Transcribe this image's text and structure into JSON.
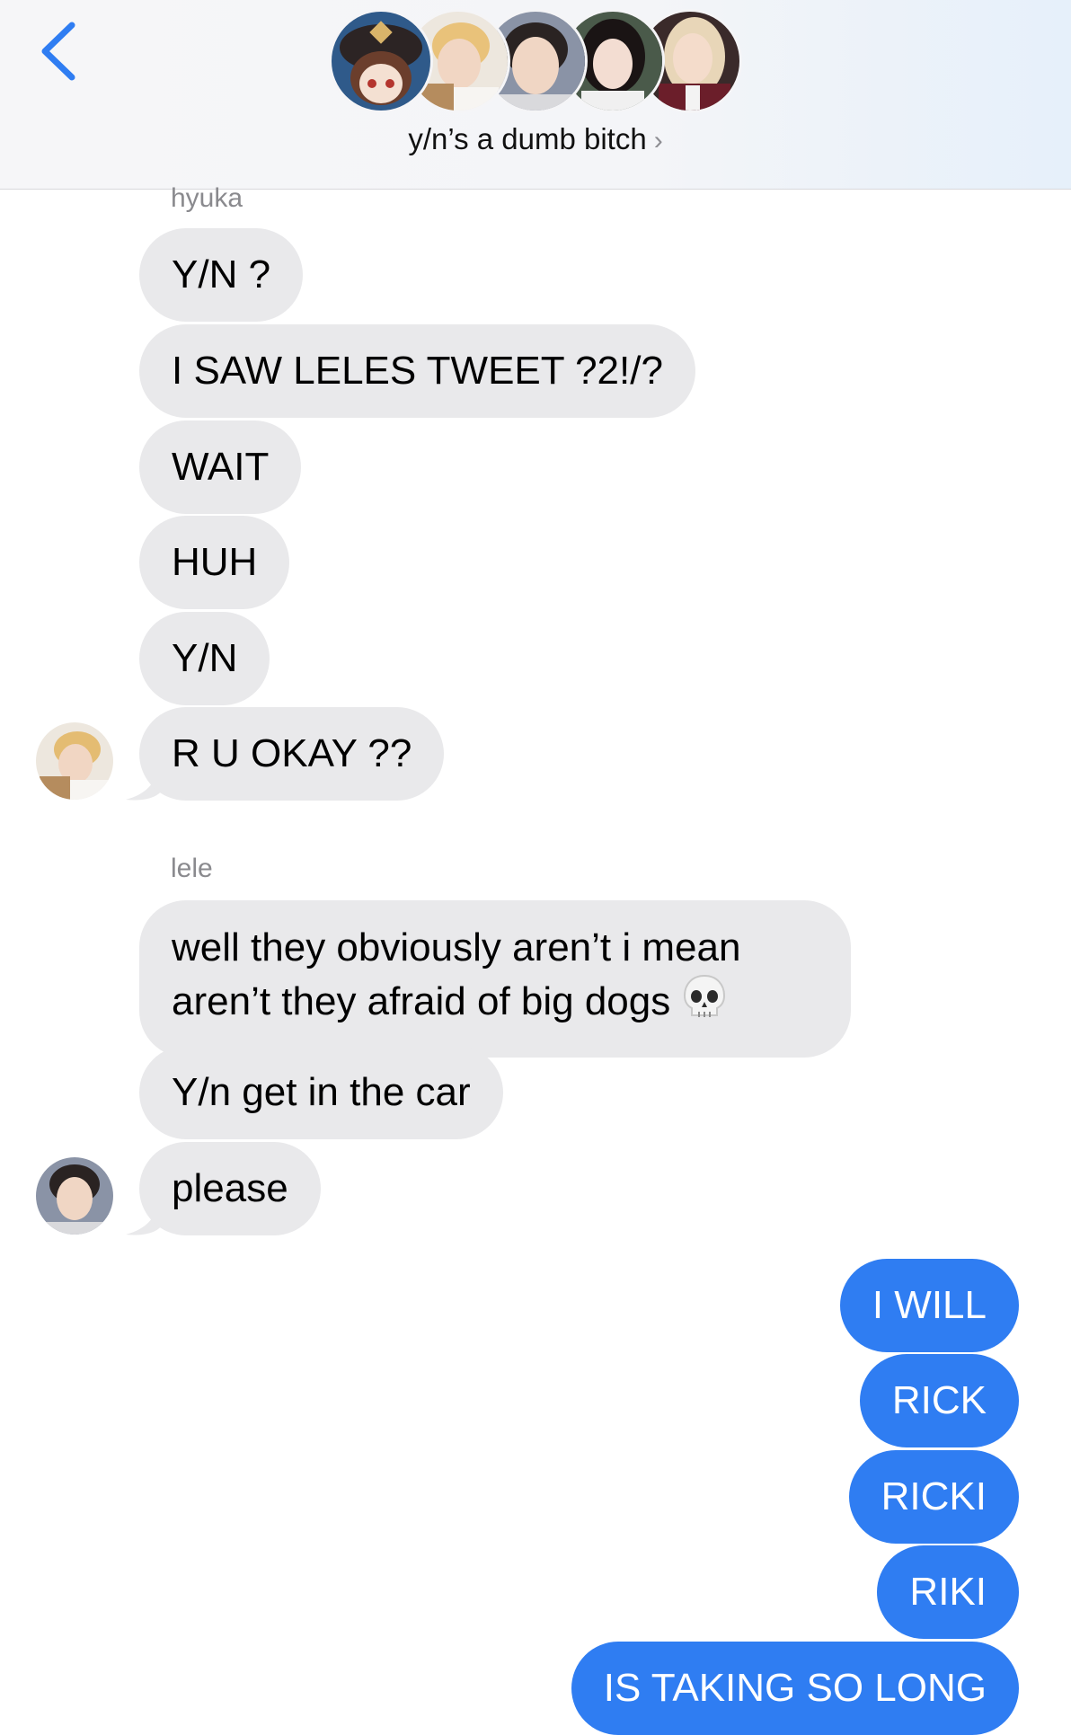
{
  "header": {
    "title": "y/n’s a dumb bitch",
    "title_chevron": "›",
    "back_icon": "chevron-left-icon",
    "accent_color": "#2f7df2",
    "group_avatars": [
      "avatar-anime-hat",
      "avatar-blonde-boy",
      "avatar-dark-hair-boy",
      "avatar-dark-hair-girl",
      "avatar-blonde-girl"
    ]
  },
  "conversation": {
    "groups": [
      {
        "sender": "hyuka",
        "messages": [
          "Y/N ?",
          "I SAW LELES TWEET ?2!/?",
          "WAIT",
          "HUH",
          "Y/N",
          "R U OKAY ??"
        ]
      },
      {
        "sender": "lele",
        "messages": [
          "well they obviously aren’t i mean aren’t they afraid of big dogs",
          "Y/n get in the car",
          "please"
        ],
        "emoji": "skull-emoji"
      }
    ],
    "outgoing": [
      "I WILL",
      "RICK",
      "RICKI",
      "RIKI",
      "IS TAKING SO LONG"
    ]
  },
  "colors": {
    "incoming_bubble": "#e9e9eb",
    "outgoing_bubble": "#2f7df2"
  }
}
